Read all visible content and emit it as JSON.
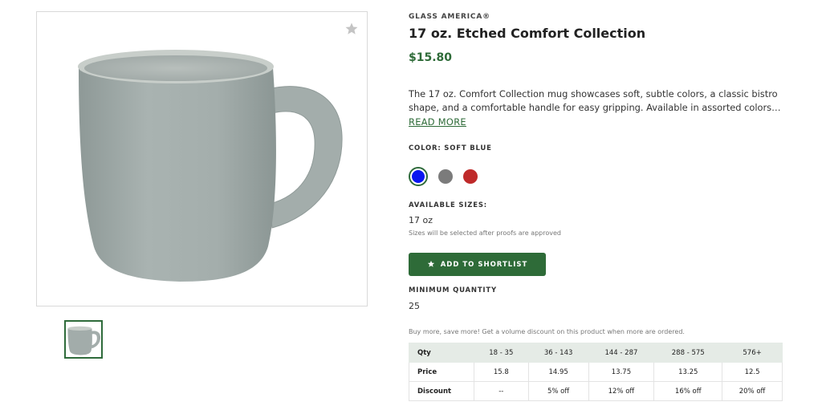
{
  "product": {
    "brand": "GLASS AMERICA®",
    "title": "17 oz. Etched Comfort Collection",
    "price": "$15.80",
    "description": "The 17 oz. Comfort Collection mug showcases soft, subtle colors, a classic bistro shape, and a comfortable handle for easy gripping. Available in assorted colors. Add...",
    "read_more": "READ MORE"
  },
  "images": {
    "favorite_icon": "star-icon",
    "main_color": "#a9b3b1"
  },
  "colors": {
    "label": "COLOR: SOFT BLUE",
    "options": [
      {
        "name": "soft-blue",
        "hex": "#0a17f0",
        "selected": true
      },
      {
        "name": "gray",
        "hex": "#7b7b7b",
        "selected": false
      },
      {
        "name": "red",
        "hex": "#bf2a2a",
        "selected": false
      }
    ]
  },
  "sizes": {
    "label": "AVAILABLE SIZES:",
    "value": "17 oz",
    "note": "Sizes will be selected after proofs are approved"
  },
  "shortlist": {
    "label": "ADD TO SHORTLIST",
    "icon": "star-icon"
  },
  "minimum": {
    "label": "MINIMUM QUANTITY",
    "value": "25"
  },
  "pricing": {
    "note": "Buy more, save more! Get a volume discount on this product when more are ordered.",
    "headers": [
      "Qty",
      "18 - 35",
      "36 - 143",
      "144 - 287",
      "288 - 575",
      "576+"
    ],
    "price_row": [
      "Price",
      "15.8",
      "14.95",
      "13.75",
      "13.25",
      "12.5"
    ],
    "discount_row": [
      "Discount",
      "--",
      "5% off",
      "12% off",
      "16% off",
      "20% off"
    ]
  },
  "theme": {
    "accent": "#2e6b38",
    "table_header_bg": "#e5ebe6"
  }
}
